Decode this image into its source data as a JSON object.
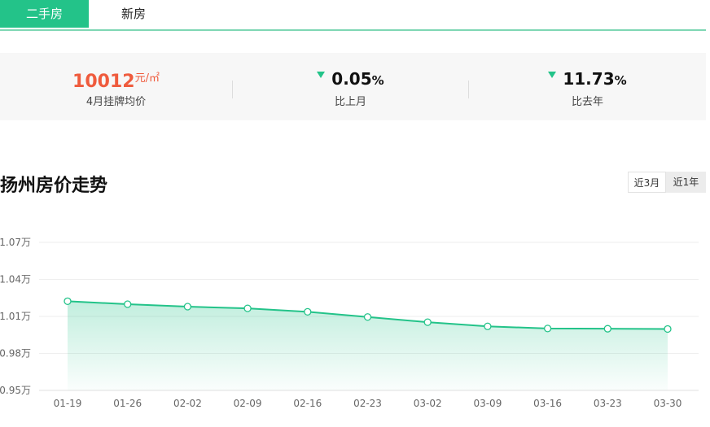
{
  "tabs": [
    {
      "label": "二手房",
      "active": true
    },
    {
      "label": "新房",
      "active": false
    }
  ],
  "stats": {
    "avg_price": {
      "value": "10012",
      "unit": "元/㎡",
      "label": "4月挂牌均价"
    },
    "mom": {
      "value": "0.05",
      "unit": "%",
      "label": "比上月",
      "direction": "down"
    },
    "yoy": {
      "value": "11.73",
      "unit": "%",
      "label": "比去年",
      "direction": "down"
    }
  },
  "section_title": "扬州房价走势",
  "range_buttons": [
    {
      "label": "近3月",
      "active": true
    },
    {
      "label": "近1年",
      "active": false
    }
  ],
  "colors": {
    "accent": "#23c389",
    "price_red": "#ef5b3d"
  },
  "chart_data": {
    "type": "area",
    "x": [
      "01-19",
      "01-26",
      "02-02",
      "02-09",
      "02-16",
      "02-23",
      "03-02",
      "03-09",
      "03-16",
      "03-23",
      "03-30"
    ],
    "y": [
      1.0223,
      1.0199,
      1.0179,
      1.0165,
      1.0137,
      1.0095,
      1.0053,
      1.0019,
      1.0002,
      1.0,
      0.9998
    ],
    "ylim": [
      0.95,
      1.07
    ],
    "yticks": [
      {
        "value": 1.07,
        "label": "1.07万"
      },
      {
        "value": 1.04,
        "label": "1.04万"
      },
      {
        "value": 1.01,
        "label": "1.01万"
      },
      {
        "value": 0.98,
        "label": "0.98万"
      },
      {
        "value": 0.95,
        "label": "0.95万"
      }
    ],
    "grid": true,
    "title": "",
    "xlabel": "",
    "ylabel": ""
  }
}
